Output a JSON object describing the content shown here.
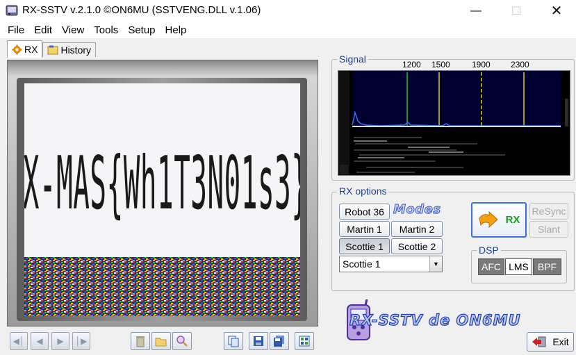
{
  "window": {
    "title": "RX-SSTV v.2.1.0 ©ON6MU (SSTVENG.DLL v.1.06)",
    "minimize_icon": "minimize-icon",
    "maximize_icon": "maximize-icon",
    "close_icon": "close-icon"
  },
  "menu": [
    "File",
    "Edit",
    "View",
    "Tools",
    "Setup",
    "Help"
  ],
  "tabs": [
    {
      "label": "RX",
      "icon": "gear-icon",
      "active": true
    },
    {
      "label": "History",
      "icon": "history-icon",
      "active": false
    }
  ],
  "image": {
    "decoded_text": "X-MAS{Wh1T3N01s3}"
  },
  "toolbar": {
    "nav_icons": [
      "first-icon",
      "previous-icon",
      "next-icon",
      "last-icon"
    ],
    "tool_icons": [
      "trash-icon",
      "open-folder-icon",
      "zoom-icon"
    ],
    "action_icons": [
      "copy-icon",
      "save-icon",
      "save-as-icon",
      "gallery-icon"
    ]
  },
  "signal": {
    "title": "Signal",
    "freq_labels": [
      "1200",
      "1500",
      "1900",
      "2300"
    ]
  },
  "rx_options": {
    "title": "RX options",
    "modes_label": "Modes",
    "mode_buttons": [
      "Robot 36",
      "Martin 1",
      "Martin 2",
      "Scottie 1",
      "Scottie 2"
    ],
    "selected_mode": "Scottie 1",
    "rx_button": "RX",
    "resync_button": "ReSync",
    "slant_button": "Slant"
  },
  "dsp": {
    "title": "DSP",
    "afc": "AFC",
    "lms": "LMS",
    "bpf": "BPF"
  },
  "logo": {
    "text": "RX-SSTV de ON6MU"
  },
  "exit_button": "Exit",
  "colors": {
    "group_title": "#1a3f8c",
    "rx_label": "#1c9c1c",
    "spectrum_bg": "#000030",
    "marker_green": "#22c022",
    "marker_yellow": "#e0d000"
  }
}
